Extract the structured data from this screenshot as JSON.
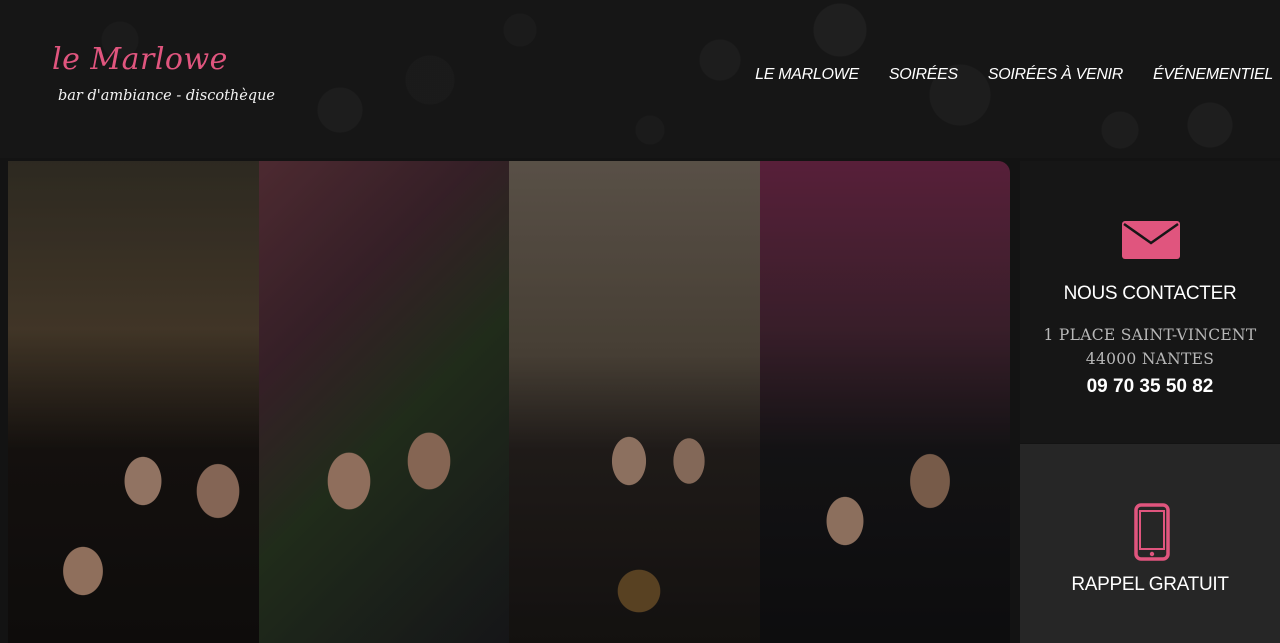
{
  "header": {
    "logo_title": "le Marlowe",
    "logo_subtitle": "bar d'ambiance - discothèque",
    "nav": [
      {
        "label": "LE MARLOWE"
      },
      {
        "label": "SOIRÉES"
      },
      {
        "label": "SOIRÉES À VENIR"
      },
      {
        "label": "ÉVÉNEMENTIEL"
      }
    ]
  },
  "colors": {
    "accent": "#e0557e",
    "background": "#131313",
    "panel_dark": "#161616",
    "panel_light": "#262626"
  },
  "contact": {
    "icon": "envelope-icon",
    "title": "NOUS CONTACTER",
    "address_line1": "1 PLACE SAINT-VINCENT",
    "address_line2": "44000 NANTES",
    "phone": "09 70 35 50 82"
  },
  "callback": {
    "icon": "mobile-phone-icon",
    "title": "RAPPEL GRATUIT"
  }
}
